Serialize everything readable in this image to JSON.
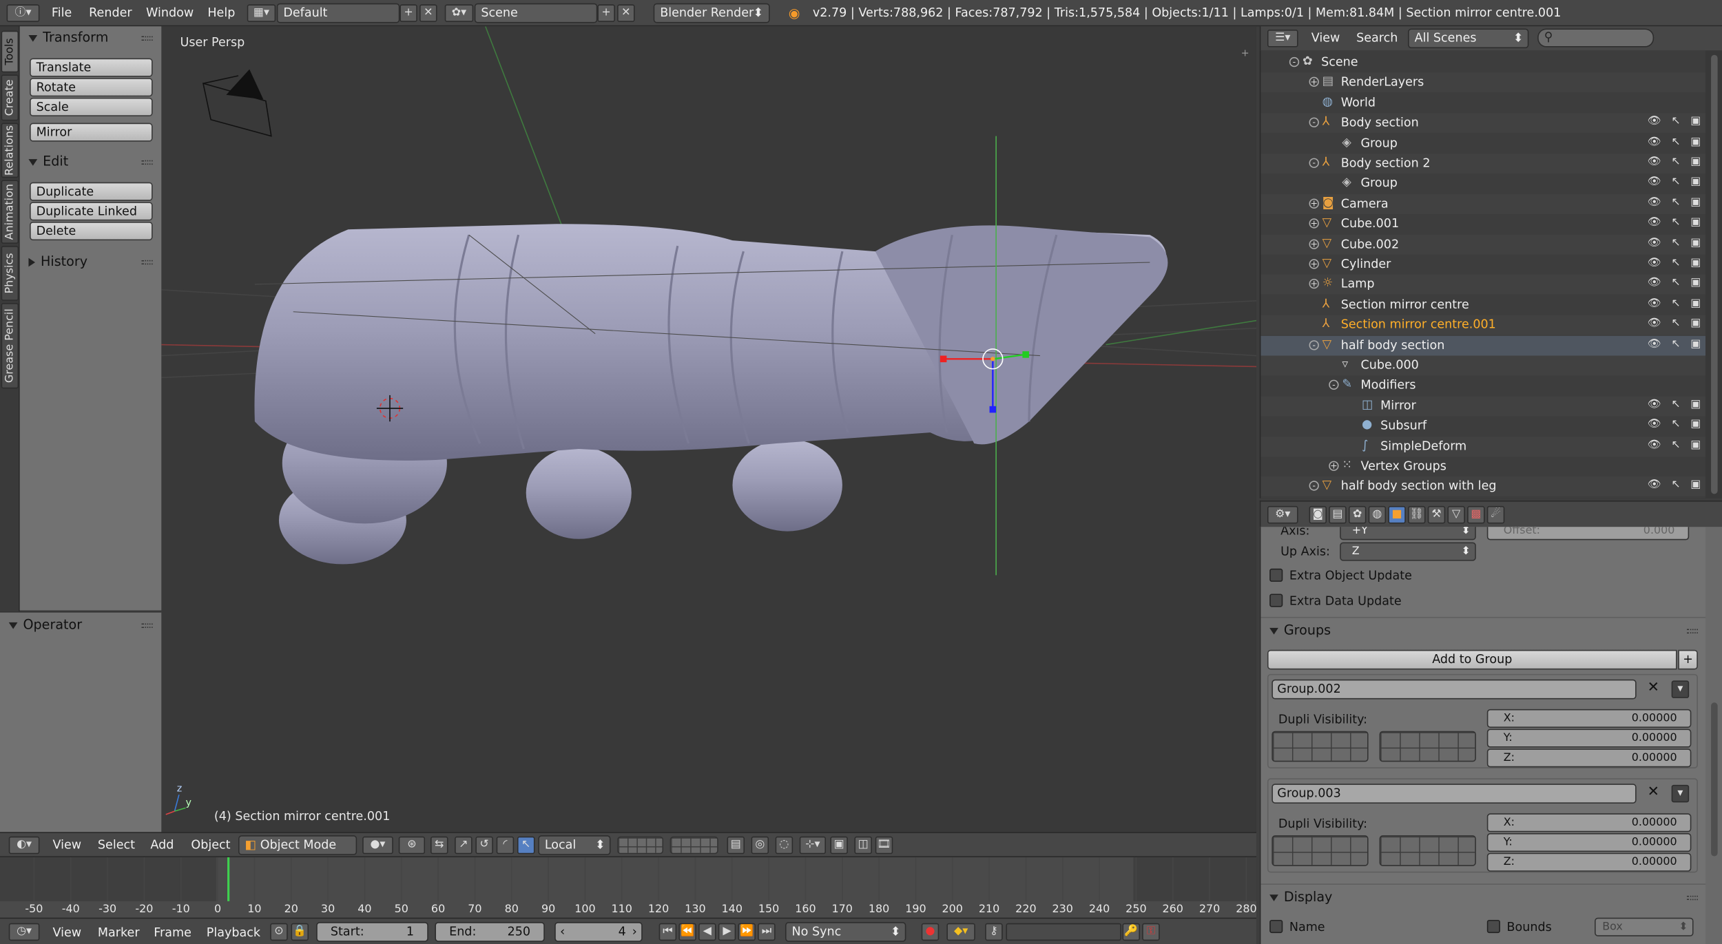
{
  "info_bar": {
    "menus": [
      "File",
      "Render",
      "Window",
      "Help"
    ],
    "screen_layout": "Default",
    "scene": "Scene",
    "engine": "Blender Render",
    "stats": "v2.79 | Verts:788,962 | Faces:787,792 | Tris:1,575,584 | Objects:1/11 | Lamps:0/1 | Mem:81.84M | Section mirror centre.001"
  },
  "tool_tabs": [
    "Tools",
    "Create",
    "Relations",
    "Animation",
    "Physics",
    "Grease Pencil"
  ],
  "toolshelf": {
    "transform": {
      "title": "Transform",
      "buttons": [
        "Translate",
        "Rotate",
        "Scale",
        "Mirror"
      ]
    },
    "edit": {
      "title": "Edit",
      "buttons": [
        "Duplicate",
        "Duplicate Linked",
        "Delete"
      ]
    },
    "history": {
      "title": "History"
    },
    "operator": {
      "title": "Operator"
    }
  },
  "viewport": {
    "view_label": "User Persp",
    "object_label": "(4) Section mirror centre.001",
    "axis_z": "z",
    "axis_y": "y"
  },
  "view3d_header": {
    "menus": [
      "View",
      "Select",
      "Add",
      "Object"
    ],
    "mode": "Object Mode",
    "orientation": "Local"
  },
  "timeline": {
    "ticks": [
      "-50",
      "-40",
      "-30",
      "-20",
      "-10",
      "0",
      "10",
      "20",
      "30",
      "40",
      "50",
      "60",
      "70",
      "80",
      "90",
      "100",
      "110",
      "120",
      "130",
      "140",
      "150",
      "160",
      "170",
      "180",
      "190",
      "200",
      "210",
      "220",
      "230",
      "240",
      "250",
      "260",
      "270",
      "280"
    ],
    "current_frame": 4
  },
  "timeline_header": {
    "menus": [
      "View",
      "Marker",
      "Frame",
      "Playback"
    ],
    "start_label": "Start:",
    "start": "1",
    "end_label": "End:",
    "end": "250",
    "frame": "4",
    "sync": "No Sync"
  },
  "outliner": {
    "menus": [
      "View",
      "Search"
    ],
    "filter": "All Scenes",
    "rows": [
      {
        "label": "Scene",
        "depth": 0,
        "icon": "scene-icon",
        "exp": "-"
      },
      {
        "label": "RenderLayers",
        "depth": 1,
        "icon": "renderlayers-icon",
        "exp": "+"
      },
      {
        "label": "World",
        "depth": 1,
        "icon": "world-icon",
        "exp": ""
      },
      {
        "label": "Body section",
        "depth": 1,
        "icon": "empty-icon",
        "exp": "-",
        "vis": true
      },
      {
        "label": "Group",
        "depth": 2,
        "icon": "group-icon",
        "exp": "",
        "vis": true
      },
      {
        "label": "Body section 2",
        "depth": 1,
        "icon": "empty-icon",
        "exp": "-",
        "vis": true
      },
      {
        "label": "Group",
        "depth": 2,
        "icon": "group-icon",
        "exp": "",
        "vis": true
      },
      {
        "label": "Camera",
        "depth": 1,
        "icon": "camera-icon",
        "exp": "+",
        "vis": true
      },
      {
        "label": "Cube.001",
        "depth": 1,
        "icon": "mesh-icon",
        "exp": "+",
        "vis": true
      },
      {
        "label": "Cube.002",
        "depth": 1,
        "icon": "mesh-icon",
        "exp": "+",
        "vis": true
      },
      {
        "label": "Cylinder",
        "depth": 1,
        "icon": "mesh-icon",
        "exp": "+",
        "vis": true
      },
      {
        "label": "Lamp",
        "depth": 1,
        "icon": "lamp-icon",
        "exp": "+",
        "vis": true
      },
      {
        "label": "Section mirror centre",
        "depth": 1,
        "icon": "empty-icon",
        "exp": "",
        "vis": true
      },
      {
        "label": "Section mirror centre.001",
        "depth": 1,
        "icon": "empty-icon",
        "exp": "",
        "vis": true,
        "active": true
      },
      {
        "label": "half body section",
        "depth": 1,
        "icon": "mesh-icon",
        "exp": "-",
        "vis": true,
        "selected": true
      },
      {
        "label": "Cube.000",
        "depth": 2,
        "icon": "meshdata-icon",
        "exp": ""
      },
      {
        "label": "Modifiers",
        "depth": 2,
        "icon": "wrench-icon",
        "exp": "-"
      },
      {
        "label": "Mirror",
        "depth": 3,
        "icon": "mirror-icon",
        "exp": "",
        "vis": true
      },
      {
        "label": "Subsurf",
        "depth": 3,
        "icon": "subsurf-icon",
        "exp": "",
        "vis": true
      },
      {
        "label": "SimpleDeform",
        "depth": 3,
        "icon": "simpledeform-icon",
        "exp": "",
        "vis": true
      },
      {
        "label": "Vertex Groups",
        "depth": 2,
        "icon": "vertexgroups-icon",
        "exp": "+"
      },
      {
        "label": "half body section with leg",
        "depth": 1,
        "icon": "mesh-icon",
        "exp": "-",
        "vis": true
      }
    ]
  },
  "properties": {
    "axis_label": "Axis:",
    "axis_value": "+Y",
    "offset_label": "Offset:",
    "offset_value": "0.000",
    "up_axis_label": "Up Axis:",
    "up_axis_value": "Z",
    "extra_object_update": "Extra Object Update",
    "extra_data_update": "Extra Data Update",
    "groups_title": "Groups",
    "add_to_group": "Add to Group",
    "groups": [
      {
        "name": "Group.002",
        "dupli_label": "Dupli Visibility:",
        "x": "0.00000",
        "y": "0.00000",
        "z": "0.00000"
      },
      {
        "name": "Group.003",
        "dupli_label": "Dupli Visibility:",
        "x": "0.00000",
        "y": "0.00000",
        "z": "0.00000"
      }
    ],
    "display_title": "Display",
    "name_label": "Name",
    "bounds_label": "Bounds",
    "bounds_type": "Box",
    "x_label": "X:",
    "y_label": "Y:",
    "z_label": "Z:"
  },
  "colors": {
    "accent": "#5680c2",
    "selected_text": "#ffaf29",
    "object_color": "#9c9cb6"
  }
}
